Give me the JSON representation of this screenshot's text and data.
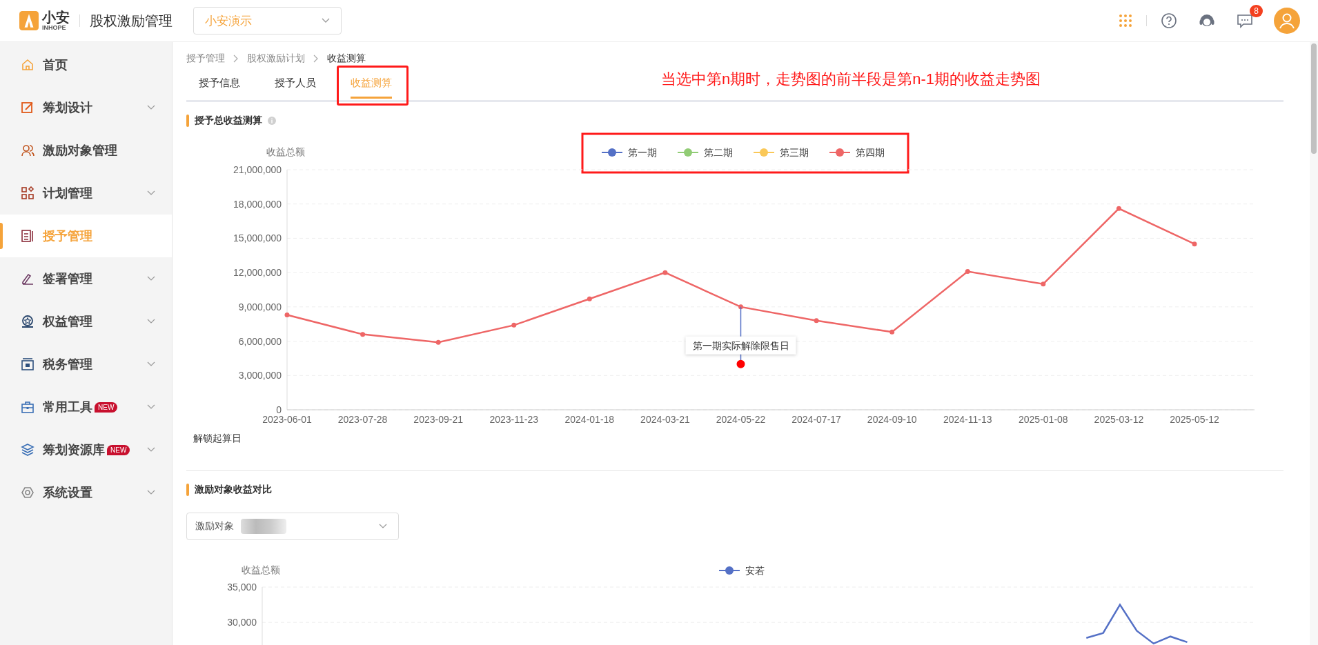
{
  "header": {
    "logo_text": "小安",
    "logo_subtext": "INHOPE",
    "app_title": "股权激励管理",
    "company_select": {
      "value": "小安演示"
    },
    "notification_count": "8"
  },
  "sidebar": {
    "items": [
      {
        "label": "首页",
        "selected": false,
        "expandable": false
      },
      {
        "label": "筹划设计",
        "selected": false,
        "expandable": true
      },
      {
        "label": "激励对象管理",
        "selected": false,
        "expandable": false
      },
      {
        "label": "计划管理",
        "selected": false,
        "expandable": true
      },
      {
        "label": "授予管理",
        "selected": true,
        "expandable": false
      },
      {
        "label": "签署管理",
        "selected": false,
        "expandable": true
      },
      {
        "label": "权益管理",
        "selected": false,
        "expandable": true
      },
      {
        "label": "税务管理",
        "selected": false,
        "expandable": true
      },
      {
        "label": "常用工具",
        "selected": false,
        "expandable": true,
        "badge": "NEW"
      },
      {
        "label": "筹划资源库",
        "selected": false,
        "expandable": true,
        "badge": "NEW"
      },
      {
        "label": "系统设置",
        "selected": false,
        "expandable": true
      }
    ]
  },
  "breadcrumb": [
    "授予管理",
    "股权激励计划",
    "收益测算"
  ],
  "tabs": [
    {
      "label": "授予信息",
      "selected": false
    },
    {
      "label": "授予人员",
      "selected": false
    },
    {
      "label": "收益测算",
      "selected": true
    }
  ],
  "note": "当选中第n期时，走势图的前半段是第n-1期的收益走势图",
  "total_section": {
    "title": "授予总收益测算",
    "chart_data": {
      "type": "line",
      "ylabel": "收益总额",
      "xlabel": "解锁起算日",
      "grid": true,
      "categories": [
        "2023-06-01",
        "2023-07-28",
        "2023-09-21",
        "2023-11-23",
        "2024-01-18",
        "2024-03-21",
        "2024-05-22",
        "2024-07-17",
        "2024-09-10",
        "2024-11-13",
        "2025-01-08",
        "2025-03-12",
        "2025-05-12"
      ],
      "series": [
        {
          "name": "第一期",
          "color": "#5470c6",
          "values": [
            null,
            null,
            null,
            null,
            null,
            null,
            null,
            null,
            null,
            null,
            null,
            null,
            null
          ]
        },
        {
          "name": "第二期",
          "color": "#91cc75",
          "values": [
            null,
            null,
            null,
            null,
            null,
            null,
            null,
            null,
            null,
            null,
            null,
            null,
            null
          ]
        },
        {
          "name": "第三期",
          "color": "#fac858",
          "values": [
            null,
            null,
            null,
            null,
            null,
            null,
            null,
            null,
            null,
            null,
            null,
            null,
            null
          ]
        },
        {
          "name": "第四期",
          "color": "#ee6666",
          "marker": "circle",
          "values": [
            8300000,
            6600000,
            5900000,
            7400000,
            9700000,
            12000000,
            9000000,
            7800000,
            6800000,
            12100000,
            11000000,
            17600000,
            14500000
          ]
        }
      ],
      "ylim": [
        0,
        21000000
      ],
      "yticks": [
        {
          "value": 0,
          "label": "0"
        },
        {
          "value": 3000000,
          "label": "3,000,000"
        },
        {
          "value": 6000000,
          "label": "6,000,000"
        },
        {
          "value": 9000000,
          "label": "9,000,000"
        },
        {
          "value": 12000000,
          "label": "12,000,000"
        },
        {
          "value": 15000000,
          "label": "15,000,000"
        },
        {
          "value": 18000000,
          "label": "18,000,000"
        },
        {
          "value": 21000000,
          "label": "21,000,000"
        }
      ],
      "annotations": [
        {
          "text": "第一期实际解除限售日",
          "x": "2024-05-22",
          "y": 4000000
        }
      ]
    }
  },
  "compare_section": {
    "title": "激励对象收益对比",
    "select_label": "激励对象",
    "chart_data": {
      "type": "line",
      "ylabel": "收益总额",
      "grid": true,
      "ylim": [
        26700,
        35000
      ],
      "series": [
        {
          "name": "安若",
          "color": "#5470c6",
          "values": [
            null,
            null,
            null,
            null,
            null,
            null,
            null,
            null,
            null,
            null,
            null,
            null,
            null,
            null,
            null,
            null,
            null,
            null,
            null,
            null,
            null,
            null,
            null,
            null,
            null,
            null,
            null,
            null,
            null,
            null,
            null,
            null,
            null,
            null,
            null,
            null,
            null,
            null,
            null,
            null,
            null,
            null,
            null,
            null,
            null,
            null,
            null,
            null,
            null,
            27800,
            28500,
            32500,
            28800,
            27000,
            28000,
            27200,
            null,
            null,
            null,
            null
          ]
        }
      ],
      "yticks": [
        {
          "value": 30000,
          "label": "30,000"
        },
        {
          "value": 35000,
          "label": "35,000"
        }
      ]
    }
  }
}
